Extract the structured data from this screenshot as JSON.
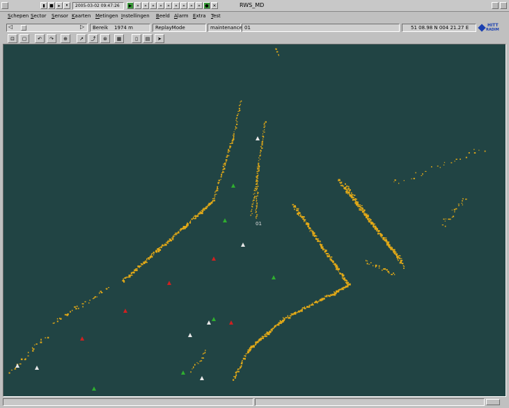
{
  "window": {
    "title": "RWS_MD",
    "datetime": "2005-03-02 09:47:26"
  },
  "menu": [
    "Schepen",
    "Sector",
    "Sensor",
    "Kaarten",
    "Metingen",
    "Instellingen",
    "Beeld",
    "Alarm",
    "Extra",
    "Test"
  ],
  "status": {
    "range_label": "Bereik",
    "range_value": "1974 m",
    "mode": "ReplayMode",
    "user": "maintenance",
    "sensor_id": "01",
    "coordinates": "51 08.98 N  004 21.27 E",
    "logo_line1": "HITT",
    "logo_line2": "RADIM"
  },
  "radar": {
    "target_label": "01",
    "echo_color": "#e0a818",
    "background_color": "#214444",
    "target_colors": {
      "green": "#2fae2f",
      "red": "#d02020",
      "white": "#e8e8e8"
    }
  },
  "icons": {
    "titlebar_left": "window-menu-icon",
    "toolbar": [
      "zoom-in-icon",
      "zoom-out-icon",
      "undo-icon",
      "redo-icon",
      "center-icon",
      "measure-icon",
      "route-icon",
      "target-icon",
      "history-icon",
      "grid-icon",
      "keyboard-icon",
      "pointer-icon"
    ]
  }
}
